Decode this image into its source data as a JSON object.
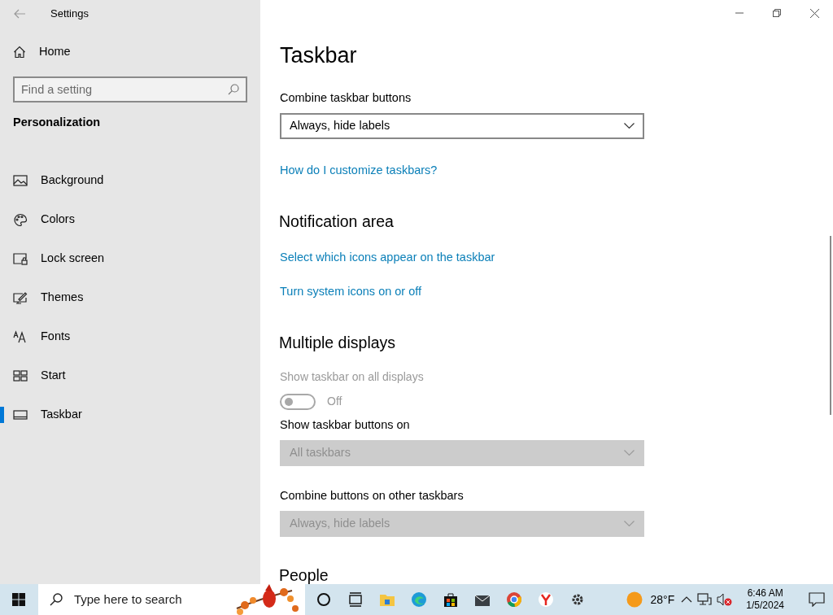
{
  "window": {
    "title": "Settings"
  },
  "sidebar": {
    "home": "Home",
    "search": {
      "placeholder": "Find a setting"
    },
    "section": "Personalization",
    "items": [
      {
        "label": "Background",
        "selected": false
      },
      {
        "label": "Colors",
        "selected": false
      },
      {
        "label": "Lock screen",
        "selected": false
      },
      {
        "label": "Themes",
        "selected": false
      },
      {
        "label": "Fonts",
        "selected": false
      },
      {
        "label": "Start",
        "selected": false
      },
      {
        "label": "Taskbar",
        "selected": true
      }
    ]
  },
  "page": {
    "title": "Taskbar",
    "sections": [
      {
        "kind": "dropdown",
        "label": "Combine taskbar buttons",
        "value": "Always, hide labels",
        "disabled": false
      },
      {
        "kind": "link",
        "text": "How do I customize taskbars?"
      },
      {
        "kind": "heading",
        "text": "Notification area"
      },
      {
        "kind": "link",
        "text": "Select which icons appear on the taskbar"
      },
      {
        "kind": "link",
        "text": "Turn system icons on or off"
      },
      {
        "kind": "heading",
        "text": "Multiple displays"
      },
      {
        "kind": "toggle",
        "label": "Show taskbar on all displays",
        "on": false,
        "state_text": "Off",
        "disabled": true
      },
      {
        "kind": "dropdown",
        "label": "Show taskbar buttons on",
        "value": "All taskbars",
        "disabled": true
      },
      {
        "kind": "dropdown",
        "label": "Combine buttons on other taskbars",
        "value": "Always, hide labels",
        "disabled": true
      },
      {
        "kind": "heading",
        "text": "People"
      }
    ]
  },
  "taskbar": {
    "search": {
      "placeholder": "Type here to search"
    },
    "weather": "28°F",
    "time": "6:46 AM",
    "date": "1/5/2024"
  }
}
